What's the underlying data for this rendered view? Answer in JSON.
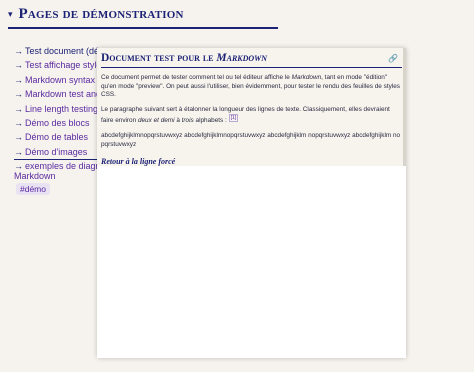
{
  "page": {
    "title": "Pages de démonstration",
    "nav_items": [
      {
        "label": "Test document (démo"
      },
      {
        "label": "Test affichage styles (c"
      },
      {
        "label": "Markdown syntax dem"
      },
      {
        "label": "Markdown test and de"
      },
      {
        "label": "Line length testing"
      },
      {
        "label": "Démo des blocs"
      },
      {
        "label": "Démo de tables"
      },
      {
        "label": "Démo d'images"
      },
      {
        "label": "exemples de diagramm"
      }
    ],
    "arrow": "→",
    "category": "Markdown",
    "tag": "#démo"
  },
  "popup": {
    "title_prefix": "Document test pour le ",
    "title_emph": "Markdown",
    "link_icon": "🔗",
    "p1_a": "Ce document permet de tester comment tel ou tel éditeur affiche le ",
    "p1_b": "Markdown",
    "p1_c": ", tant en mode \"édition\" qu'en mode \"preview\". On peut aussi l'utiliser, bien évidemment, pour tester le rendu des feuilles de styles CSS.",
    "p2_a": "Le paragraphe suivant sert à étalonner la longueur des lignes de texte. Classiquement, elles devraient faire environ ",
    "p2_b": "deux et demi",
    "p2_c": " à ",
    "p2_d": "trois",
    "p2_e": " alphabets : ",
    "footnote": "[1]",
    "alphabet_line": "abcdefghijklmnopqrstuvwxyz abcdefghijklmnopqrstuvwxyz abcdefghijklm nopqrstuvwxyz abcdefghijklm nopqrstuvwxyz",
    "subheading": "Retour à la ligne forcé"
  }
}
